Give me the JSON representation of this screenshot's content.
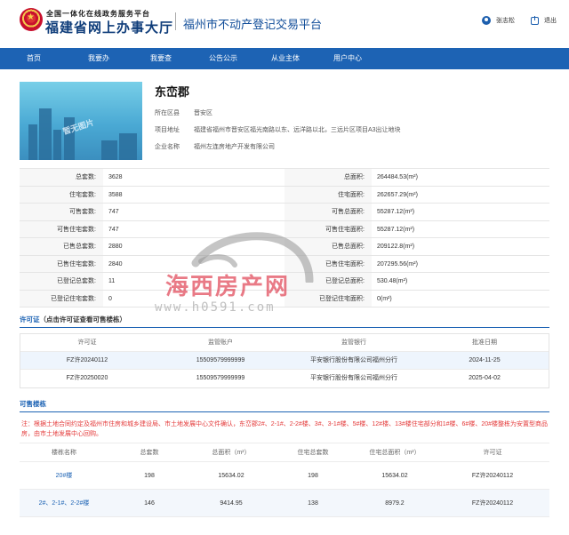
{
  "header": {
    "logo_top": "全国一体化在线政务服务平台",
    "logo_main": "福建省网上办事大厅",
    "platform_title": "福州市不动产登记交易平台",
    "user_name": "张志松",
    "logout_label": "退出"
  },
  "nav": [
    "首页",
    "我要办",
    "我要查",
    "公告公示",
    "从业主体",
    "用户中心"
  ],
  "project": {
    "image_caption": "暂无图片",
    "name": "东峦郡",
    "fields": [
      {
        "label": "所在区县",
        "value": "晋安区"
      },
      {
        "label": "项目地址",
        "value": "福建省福州市晋安区福光南路以东、远洋路以北，三远片区项目A3出让地块"
      },
      {
        "label": "企业名称",
        "value": "福州左连房地产开发有限公司"
      }
    ]
  },
  "stats": [
    {
      "l1": "总套数:",
      "v1": "3628",
      "l2": "总面积:",
      "v2": "264484.53(m²)"
    },
    {
      "l1": "住宅套数:",
      "v1": "3588",
      "l2": "住宅面积:",
      "v2": "262657.29(m²)"
    },
    {
      "l1": "可售套数:",
      "v1": "747",
      "l2": "可售总面积:",
      "v2": "55287.12(m²)"
    },
    {
      "l1": "可售住宅套数:",
      "v1": "747",
      "l2": "可售住宅面积:",
      "v2": "55287.12(m²)"
    },
    {
      "l1": "已售总套数:",
      "v1": "2880",
      "l2": "已售总面积:",
      "v2": "209122.8(m²)"
    },
    {
      "l1": "已售住宅套数:",
      "v1": "2840",
      "l2": "已售住宅面积:",
      "v2": "207295.56(m²)"
    },
    {
      "l1": "已登记总套数:",
      "v1": "11",
      "l2": "已登记总面积:",
      "v2": "530.48(m²)"
    },
    {
      "l1": "已登记住宅套数:",
      "v1": "0",
      "l2": "已登记住宅面积:",
      "v2": "0(m²)"
    }
  ],
  "license": {
    "title": "许可证",
    "subtitle": "（点击许可证查看可售楼栋）",
    "headers": [
      "许可证",
      "监管账户",
      "监管银行",
      "批准日期"
    ],
    "rows": [
      [
        "FZ许20240112",
        "15509579999999",
        "平安银行股份有限公司福州分行",
        "2024-11-25"
      ],
      [
        "FZ许20250020",
        "15509579999999",
        "平安银行股份有限公司福州分行",
        "2025-04-02"
      ]
    ]
  },
  "sale": {
    "title": "可售楼栋",
    "note": "注：根据土地合同约定及福州市住房和城乡建设局、市土地发展中心文件确认，东峦郡2#、2-1#、2-2#楼、3#、3-1#楼、5#楼、12#楼、13#楼住宅部分和1#楼、6#楼、20#楼整栋为安置型商品房，由市土地发展中心回购。",
    "headers": [
      "楼栋名称",
      "总套数",
      "总面积（m²）",
      "住宅总套数",
      "住宅总面积（m²）",
      "许可证"
    ],
    "rows": [
      [
        "20#楼",
        "198",
        "15634.02",
        "198",
        "15634.02",
        "FZ许20240112"
      ],
      [
        "2#、2-1#、2-2#楼",
        "146",
        "9414.95",
        "138",
        "8979.2",
        "FZ许20240112"
      ]
    ]
  },
  "watermark": {
    "text": "海西房产网",
    "url": "www.h0591.com"
  }
}
